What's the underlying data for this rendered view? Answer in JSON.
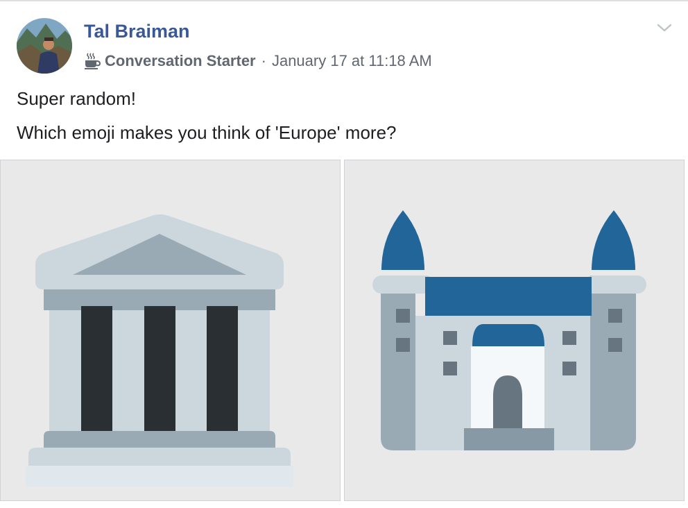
{
  "post": {
    "author": "Tal Braiman",
    "badge": {
      "label": "Conversation Starter",
      "icon": "coffee-cup-icon"
    },
    "separator": "·",
    "timestamp": "January 17 at 11:18 AM",
    "text_lines": [
      "Super random!",
      "Which emoji makes you think of 'Europe' more?"
    ],
    "options": [
      {
        "icon": "classical-building-icon"
      },
      {
        "icon": "castle-icon"
      }
    ]
  },
  "colors": {
    "author": "#385898",
    "meta": "#616770",
    "text": "#1c1e21",
    "option_bg": "#e9e9e9",
    "castle_blue": "#2a6aa3"
  }
}
